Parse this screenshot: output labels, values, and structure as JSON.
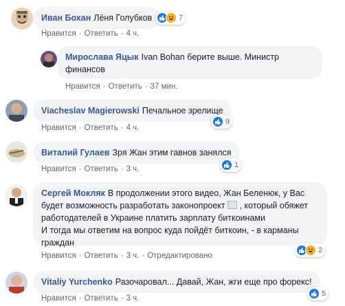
{
  "colors": {
    "author": "#385898",
    "bubble": "#f2f3f5",
    "meta": "#606770",
    "like": "#1877f2",
    "haha": "#f7b125"
  },
  "actions": {
    "like": "Нравится",
    "reply": "Ответить",
    "sep": "·",
    "edited": "Отредактировано"
  },
  "comments": [
    {
      "author": "Иван Бохан",
      "text": "Лёня Голубков",
      "time": "4 ч.",
      "reactions_count": "7",
      "reaction_icons": [
        "like-icon",
        "haha-icon"
      ]
    },
    {
      "author": "Мирослава Яцык",
      "text": "Ivan Bohan берите выше. Министр",
      "text2": "финансов",
      "time": "37 мин."
    },
    {
      "author": "Viacheslav Magierowski",
      "text": "Печальное зрелище",
      "time": "4 ч.",
      "reactions_count": "9",
      "reaction_icons": [
        "like-icon"
      ]
    },
    {
      "author": "Виталий Гулаев",
      "text": "Зря Жан этим гавнов занялся",
      "time": "3 ч.",
      "reactions_count": "1",
      "reaction_icons": [
        "like-icon"
      ]
    },
    {
      "author": "Сергей Мокляк",
      "text": "В продолжении этого видео, Жан Беленюк, у Вас",
      "text2": "будет возможность разработать законопроект",
      "text2b": ", который обяжет",
      "text3": "работодателей в Украине платить зарплату биткоинами",
      "text4": "И тогда мы ответим на вопрос куда пойдёт биткоин, - в карманы",
      "text5": "граждан",
      "time": "3 ч.",
      "reactions_count": "2",
      "reaction_icons": [
        "like-icon",
        "haha-icon"
      ]
    },
    {
      "author": "Vitaliy Yurchenko",
      "text": "Разочаровал... Давай, Жан, жги еще про форекс!",
      "time": "3 ч.",
      "reactions_count": "5",
      "reaction_icons": [
        "like-icon"
      ]
    }
  ]
}
